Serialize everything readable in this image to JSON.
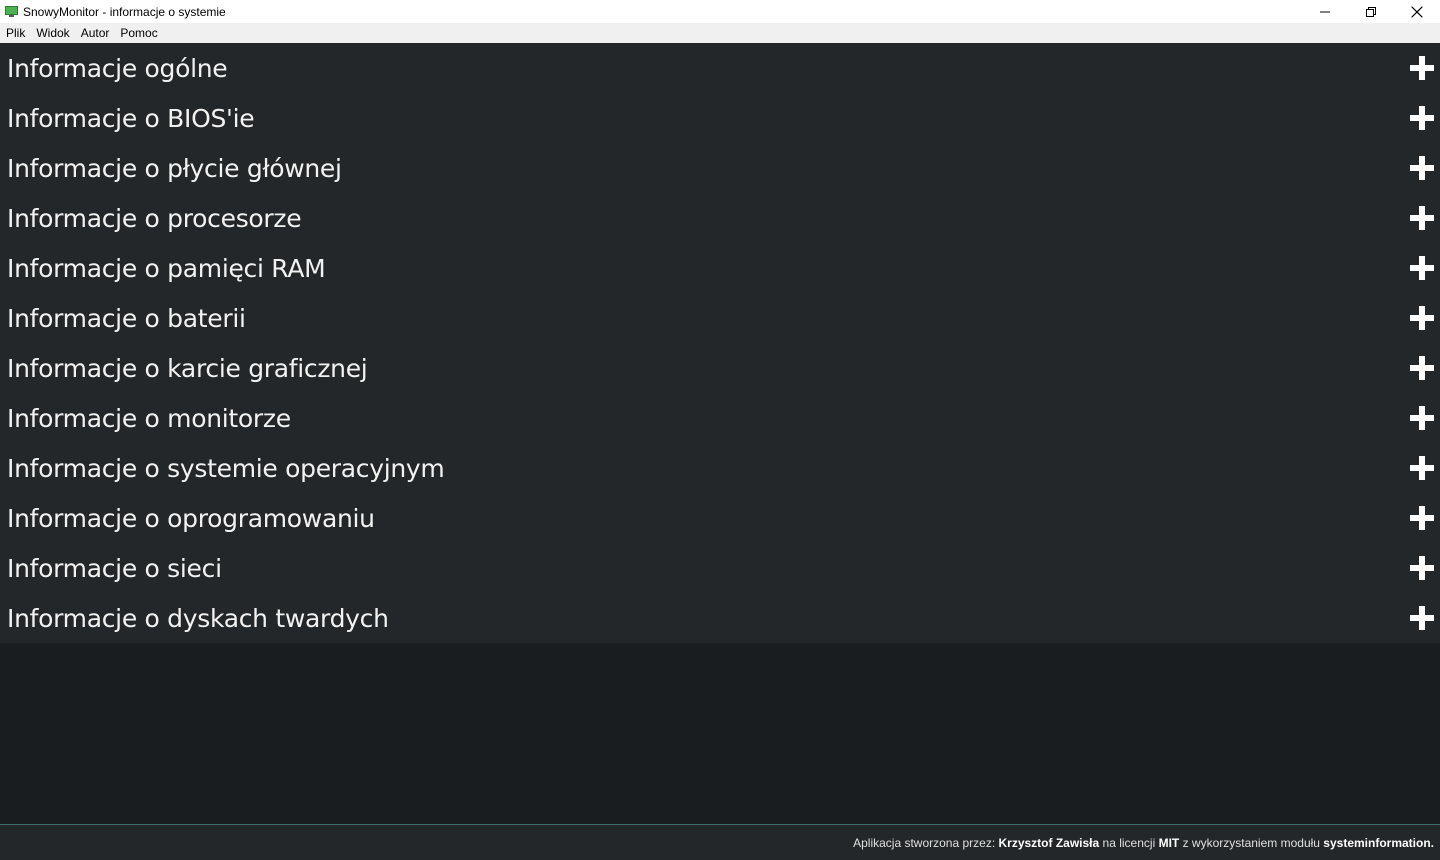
{
  "window": {
    "title": "SnowyMonitor - informacje o systemie"
  },
  "menu": [
    "Plik",
    "Widok",
    "Autor",
    "Pomoc"
  ],
  "sections": [
    "Informacje ogólne",
    "Informacje o BIOS'ie",
    "Informacje o płycie głównej",
    "Informacje o procesorze",
    "Informacje o pamięci RAM",
    "Informacje o baterii",
    "Informacje o karcie graficznej",
    "Informacje o monitorze",
    "Informacje o systemie operacyjnym",
    "Informacje o oprogramowaniu",
    "Informacje o sieci",
    "Informacje o dyskach twardych"
  ],
  "footer": {
    "prefix": "Aplikacja stworzona przez: ",
    "author": "Krzysztof Zawisła",
    "mid": " na licencji ",
    "license": "MIT",
    "mid2": " z wykorzystaniem modułu ",
    "module": "systeminformation."
  },
  "colors": {
    "section_bg": "#232729",
    "content_bg": "#1a1d1f",
    "text": "#f2f2f2"
  }
}
